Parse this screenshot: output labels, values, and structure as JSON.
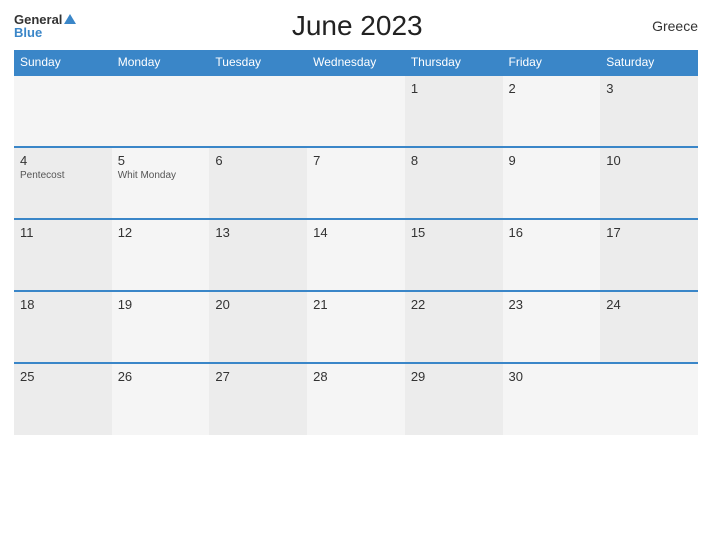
{
  "header": {
    "title": "June 2023",
    "country": "Greece",
    "logo_general": "General",
    "logo_blue": "Blue"
  },
  "days_of_week": [
    "Sunday",
    "Monday",
    "Tuesday",
    "Wednesday",
    "Thursday",
    "Friday",
    "Saturday"
  ],
  "weeks": [
    [
      {
        "num": "",
        "holiday": ""
      },
      {
        "num": "",
        "holiday": ""
      },
      {
        "num": "",
        "holiday": ""
      },
      {
        "num": "",
        "holiday": ""
      },
      {
        "num": "1",
        "holiday": ""
      },
      {
        "num": "2",
        "holiday": ""
      },
      {
        "num": "3",
        "holiday": ""
      }
    ],
    [
      {
        "num": "4",
        "holiday": "Pentecost"
      },
      {
        "num": "5",
        "holiday": "Whit Monday"
      },
      {
        "num": "6",
        "holiday": ""
      },
      {
        "num": "7",
        "holiday": ""
      },
      {
        "num": "8",
        "holiday": ""
      },
      {
        "num": "9",
        "holiday": ""
      },
      {
        "num": "10",
        "holiday": ""
      }
    ],
    [
      {
        "num": "11",
        "holiday": ""
      },
      {
        "num": "12",
        "holiday": ""
      },
      {
        "num": "13",
        "holiday": ""
      },
      {
        "num": "14",
        "holiday": ""
      },
      {
        "num": "15",
        "holiday": ""
      },
      {
        "num": "16",
        "holiday": ""
      },
      {
        "num": "17",
        "holiday": ""
      }
    ],
    [
      {
        "num": "18",
        "holiday": ""
      },
      {
        "num": "19",
        "holiday": ""
      },
      {
        "num": "20",
        "holiday": ""
      },
      {
        "num": "21",
        "holiday": ""
      },
      {
        "num": "22",
        "holiday": ""
      },
      {
        "num": "23",
        "holiday": ""
      },
      {
        "num": "24",
        "holiday": ""
      }
    ],
    [
      {
        "num": "25",
        "holiday": ""
      },
      {
        "num": "26",
        "holiday": ""
      },
      {
        "num": "27",
        "holiday": ""
      },
      {
        "num": "28",
        "holiday": ""
      },
      {
        "num": "29",
        "holiday": ""
      },
      {
        "num": "30",
        "holiday": ""
      },
      {
        "num": "",
        "holiday": ""
      }
    ]
  ]
}
